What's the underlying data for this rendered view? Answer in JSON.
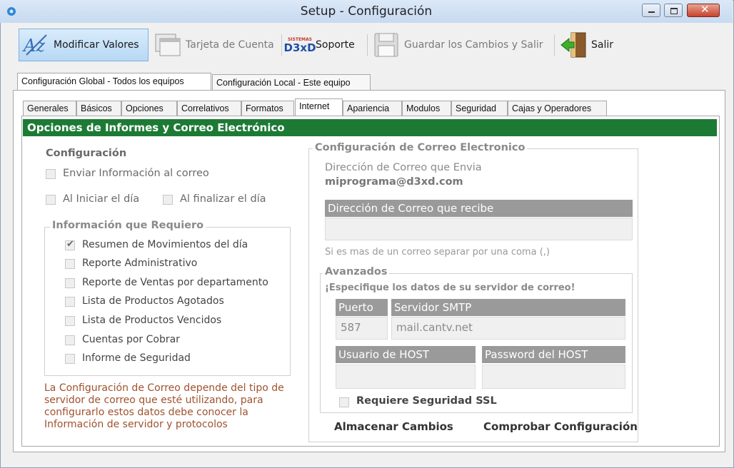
{
  "window": {
    "title": "Setup - Configuración"
  },
  "toolbar": {
    "modify": "Modificar Valores",
    "account_card": "Tarjeta de Cuenta",
    "support_logo_top": "SISTEMAS",
    "support_logo": "D3xD",
    "support": "Soporte",
    "save_exit": "Guardar los Cambios  y Salir",
    "exit": "Salir"
  },
  "outer_tabs": [
    {
      "label": "Configuración Global - Todos los equipos",
      "selected": true
    },
    {
      "label": "Configuración Local - Este equipo",
      "selected": false
    }
  ],
  "inner_tabs": [
    {
      "label": "Generales"
    },
    {
      "label": "Básicos"
    },
    {
      "label": "Opciones"
    },
    {
      "label": "Correlativos"
    },
    {
      "label": "Formatos"
    },
    {
      "label": "Internet",
      "selected": true
    },
    {
      "label": "Apariencia"
    },
    {
      "label": "Modulos"
    },
    {
      "label": "Seguridad"
    },
    {
      "label": "Cajas y Operadores"
    }
  ],
  "banner": "Opciones de Informes y Correo Electrónico",
  "config": {
    "heading": "Configuración",
    "send_email": "Enviar Información al correo",
    "on_start": "Al Iniciar el día",
    "on_end": "Al finalizar el día"
  },
  "required_info": {
    "title": "Información que Requiero",
    "items": [
      {
        "label": "Resumen de Movimientos del día",
        "checked": true
      },
      {
        "label": "Reporte Administrativo",
        "checked": false
      },
      {
        "label": "Reporte de Ventas por departamento",
        "checked": false
      },
      {
        "label": "Lista de Productos Agotados",
        "checked": false
      },
      {
        "label": "Lista de Productos Vencidos",
        "checked": false
      },
      {
        "label": "Cuentas por Cobrar",
        "checked": false
      },
      {
        "label": "Informe de Seguridad",
        "checked": false
      }
    ]
  },
  "note": {
    "line1": "La Configuración de Correo depende del tipo de",
    "line2": "servidor de correo que esté utilizando, para",
    "line3": "configurarlo estos datos debe conocer la",
    "line4": "Información de servidor y protocolos"
  },
  "email_config": {
    "title": "Configuración de Correo Electronico",
    "sender_label": "Dirección de Correo que Envia",
    "sender_value": "miprograma@d3xd.com",
    "receiver_header": "Dirección de Correo que recibe",
    "receiver_value": "",
    "hint": "Si es mas de un correo separar por una coma (,)"
  },
  "advanced": {
    "title": "Avanzados",
    "subtitle": "¡Especifique los datos de su servidor de correo!",
    "port_header": "Puerto",
    "port_value": "587",
    "smtp_header": "Servidor SMTP",
    "smtp_value": "mail.cantv.net",
    "user_header": "Usuario de HOST",
    "user_value": "",
    "password_header": "Password del HOST",
    "password_value": "",
    "ssl_label": "Requiere Seguridad SSL"
  },
  "actions": {
    "save": "Almacenar Cambios",
    "test": "Comprobar Configuración"
  },
  "colors": {
    "banner": "#1d7a35",
    "note": "#a0522d",
    "header_gray": "#9a9a9a"
  }
}
